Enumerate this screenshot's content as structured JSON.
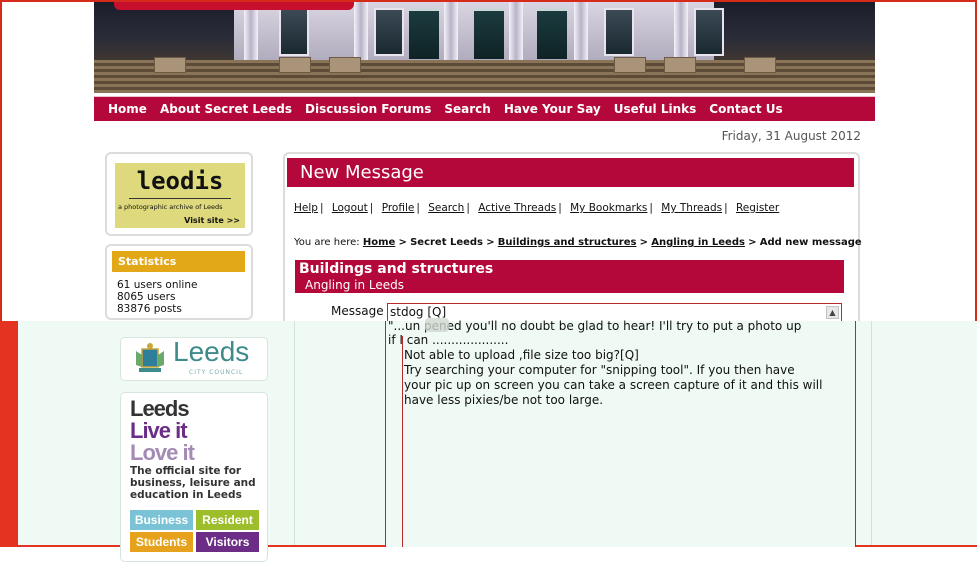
{
  "nav": {
    "items": [
      "Home",
      "About Secret Leeds",
      "Discussion Forums",
      "Search",
      "Have Your Say",
      "Useful Links",
      "Contact Us"
    ]
  },
  "date": "Friday, 31 August 2012",
  "sidebar": {
    "leodis": {
      "logo_text": "leodis",
      "tagline": "a photographic archive of Leeds",
      "visit": "Visit site >>"
    },
    "statistics": {
      "heading": "Statistics",
      "users_online": "61 users online",
      "users": "8065 users",
      "posts": "83876 posts"
    },
    "council": {
      "name": "Leeds",
      "sub": "CITY COUNCIL"
    },
    "live_it": {
      "line1": "Leeds",
      "line2": "Live it",
      "line3": "Love it",
      "description": "The official site for business, leisure and education in Leeds",
      "buttons": [
        "Business",
        "Resident",
        "Students",
        "Visitors"
      ]
    }
  },
  "main": {
    "title": "New Message",
    "user_links": [
      "Help",
      "Logout",
      "Profile",
      "Search",
      "Active Threads",
      "My Bookmarks",
      "My Threads",
      "Register"
    ],
    "breadcrumb": {
      "prefix": "You are here:",
      "home": "Home",
      "section": "Secret Leeds",
      "forum": "Buildings and structures",
      "thread": "Angling in Leeds",
      "current": "Add new message"
    },
    "forum_name": "Buildings and structures",
    "thread_name": "Angling in Leeds",
    "message_label": "Message",
    "message_lines": [
      "stdog [Q]",
      "\"...un  pened you'll no doubt be glad to hear! I'll try to put a photo up",
      "if I can ....................",
      "Not able to upload ,file size too big?[Q]",
      "Try searching your computer for \"snipping tool\".  If you then have",
      "your pic up on screen you can take a screen capture of it and this will",
      "have less pixies/be not too large."
    ]
  },
  "colors": {
    "brand": "#b5083a",
    "stats": "#e3a817",
    "frame": "#e53322"
  }
}
